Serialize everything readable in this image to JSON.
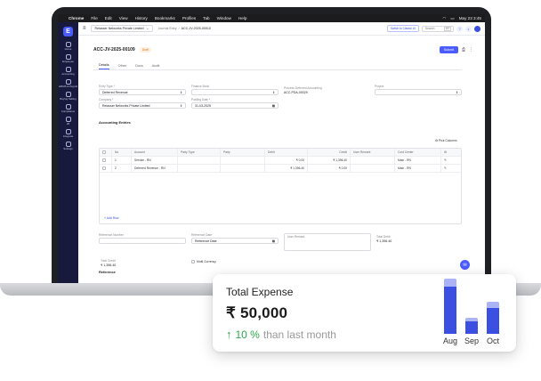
{
  "menubar": {
    "app": "Chrome",
    "items": [
      "File",
      "Edit",
      "View",
      "History",
      "Bookmarks",
      "Profiles",
      "Tab",
      "Window",
      "Help"
    ],
    "clock": "May 23 3:45"
  },
  "sidebar": {
    "logo": "E",
    "items": [
      {
        "label": "Home",
        "icon": "home-icon"
      },
      {
        "label": "Employee",
        "icon": "employee-icon"
      },
      {
        "label": "Accounting",
        "icon": "accounting-icon"
      },
      {
        "label": "HRMS & Payroll",
        "icon": "hrms-icon"
      },
      {
        "label": "Buying Selling",
        "icon": "buying-icon"
      },
      {
        "label": "Compliance",
        "icon": "compliance-icon"
      },
      {
        "label": "28",
        "icon": "calendar-icon"
      },
      {
        "label": "Integrate",
        "icon": "integrate-icon"
      },
      {
        "label": "Settings",
        "icon": "settings-icon"
      }
    ]
  },
  "topbar": {
    "company": "Relasser Networks Private Limited",
    "breadcrumb": [
      "Journal Entry",
      "ACC-JV-2025-00010"
    ],
    "switch_link": "Switch to Classic UI",
    "search_placeholder": "Search",
    "search_key": "⌘K"
  },
  "doc": {
    "title": "ACC-JV-2025-00109",
    "status": "Draft",
    "submit_label": "Submit"
  },
  "tabs": [
    "Details",
    "Other",
    "Docs",
    "Audit"
  ],
  "form": {
    "entry_type": {
      "label": "Entry Type *",
      "value": "Deferred Revenue"
    },
    "finance_book": {
      "label": "Finance Book",
      "value": ""
    },
    "prev_ref": {
      "label": "Process Deferred Accounting",
      "value": "ACC-PDA-00029"
    },
    "project": {
      "label": "Project",
      "value": ""
    },
    "company": {
      "label": "Company *",
      "value": "Relasser Networks Private Limited"
    },
    "posting_date": {
      "label": "Posting Date *",
      "value": "31-03-2025"
    }
  },
  "accounting": {
    "title": "Accounting Entries",
    "pick_columns": "Pick Columns",
    "columns": [
      "No",
      "Account",
      "Party Type",
      "Party",
      "Debit",
      "Credit",
      "User Remark",
      "Cost Center"
    ],
    "rows": [
      {
        "no": "1",
        "account": "Service - RN",
        "party_type": "",
        "party": "",
        "debit": "₹ 0.00",
        "credit": "₹ 1,396.40",
        "remark": "",
        "cost_center": "Main - RN"
      },
      {
        "no": "2",
        "account": "Deferred Revenue - RN",
        "party_type": "",
        "party": "",
        "debit": "₹ 1,396.40",
        "credit": "₹ 0.00",
        "remark": "",
        "cost_center": "Main - RN"
      }
    ],
    "add_row": "+ Add Row"
  },
  "footer_fields": {
    "ref_number": {
      "label": "Reference Number",
      "value": ""
    },
    "ref_date": {
      "label": "Reference Date",
      "value": "Reference Date"
    },
    "user_remark": {
      "label": "User Remark",
      "value": ""
    },
    "total_debit": {
      "label": "Total Debit",
      "value": "₹ 1,396.40"
    },
    "total_credit": {
      "label": "Total Credit",
      "value": "₹ 1,396.40"
    },
    "multi_currency": "Multi Currency",
    "reference_section": "Reference"
  },
  "expense_card": {
    "title": "Total Expense",
    "amount": "₹ 50,000",
    "change_pct": "10 %",
    "change_text": "than last month",
    "colors": {
      "bar_dark": "#3b4fe0",
      "bar_light": "#a9b3f5",
      "up": "#2ba84a"
    }
  },
  "chart_data": {
    "type": "bar",
    "title": "",
    "xlabel": "",
    "ylabel": "",
    "categories": [
      "Aug",
      "Sep",
      "Oct"
    ],
    "series": [
      {
        "name": "",
        "values": [
          62,
          16,
          34
        ]
      },
      {
        "name": "",
        "values": [
          10,
          5,
          8
        ]
      }
    ]
  }
}
